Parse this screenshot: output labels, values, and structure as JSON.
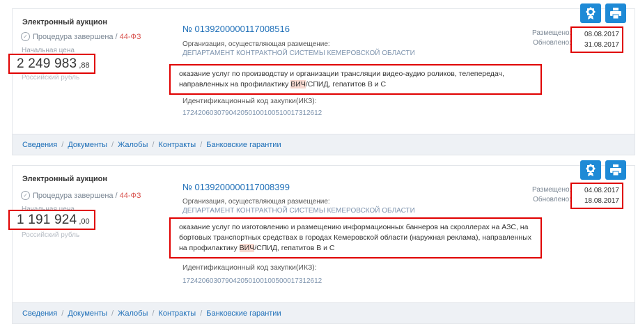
{
  "cards": [
    {
      "type": "Электронный аукцион",
      "status": "Процедура завершена",
      "law": "44-ФЗ",
      "price_label": "Начальная цена",
      "price_main": "2 249 983",
      "price_cents": ",88",
      "currency": "Российский рубль",
      "number": "№ 0139200000117008516",
      "org_label": "Организация, осуществляющая размещение:",
      "org_name": "ДЕПАРТАМЕНТ КОНТРАКТНОЙ СИСТЕМЫ КЕМЕРОВСКОЙ ОБЛАСТИ",
      "desc_before": "оказание услуг по производству и организации трансляции видео-аудио роликов, телепередач, направленных на профилактику ",
      "desc_highlight": "ВИЧ",
      "desc_after": "/СПИД, гепатитов В и С",
      "ikz_label": "Идентификационный код закупки(ИКЗ):",
      "ikz_value": "172420603079042050100100510017312612",
      "placed_label": "Размещено:",
      "updated_label": "Обновлено:",
      "placed_date": "08.08.2017",
      "updated_date": "31.08.2017",
      "icon_award": "award-icon",
      "icon_print": "print-icon"
    },
    {
      "type": "Электронный аукцион",
      "status": "Процедура завершена",
      "law": "44-ФЗ",
      "price_label": "Начальная цена",
      "price_main": "1 191 924",
      "price_cents": ",00",
      "currency": "Российский рубль",
      "number": "№ 0139200000117008399",
      "org_label": "Организация, осуществляющая размещение:",
      "org_name": "ДЕПАРТАМЕНТ КОНТРАКТНОЙ СИСТЕМЫ КЕМЕРОВСКОЙ ОБЛАСТИ",
      "desc_before": "оказание услуг по изготовлению и размещению информационных баннеров на скроллерах на АЗС, на бортовых транспортных средствах в городах Кемеровской области (наружная реклама), направленных на профилактику ",
      "desc_highlight": "ВИЧ",
      "desc_after": "/СПИД, гепатитов В и С",
      "ikz_label": "Идентификационный код закупки(ИКЗ):",
      "ikz_value": "172420603079042050100100500017312612",
      "placed_label": "Размещено:",
      "updated_label": "Обновлено:",
      "placed_date": "04.08.2017",
      "updated_date": "18.08.2017",
      "icon_award": "award-icon",
      "icon_print": "print-icon"
    }
  ],
  "footer_links": [
    "Сведения",
    "Документы",
    "Жалобы",
    "Контракты",
    "Банковские гарантии"
  ],
  "colors": {
    "accent": "#1e8ad6",
    "link": "#1e6fb8",
    "highlight_box": "#e00000",
    "law": "#d9534f"
  }
}
